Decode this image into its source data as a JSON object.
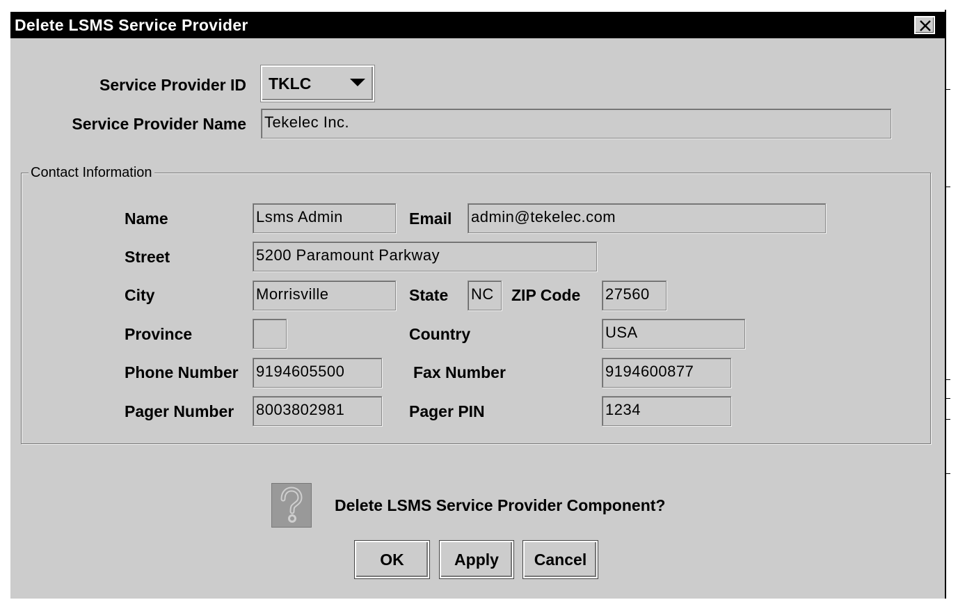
{
  "window": {
    "title": "Delete LSMS Service Provider",
    "close_icon": "close-x-icon"
  },
  "provider": {
    "id_label": "Service Provider ID",
    "id_value": "TKLC",
    "name_label": "Service Provider Name",
    "name_value": "Tekelec Inc."
  },
  "contact": {
    "legend": "Contact Information",
    "name_label": "Name",
    "name_value": "Lsms Admin",
    "email_label": "Email",
    "email_value": "admin@tekelec.com",
    "street_label": "Street",
    "street_value": "5200 Paramount Parkway",
    "city_label": "City",
    "city_value": "Morrisville",
    "state_label": "State",
    "state_value": "NC",
    "zip_label": "ZIP Code",
    "zip_value": "27560",
    "province_label": "Province",
    "province_value": "",
    "country_label": "Country",
    "country_value": "USA",
    "phone_label": "Phone Number",
    "phone_value": "9194605500",
    "fax_label": "Fax Number",
    "fax_value": "9194600877",
    "pager_label": "Pager Number",
    "pager_value": "8003802981",
    "pager_pin_label": "Pager PIN",
    "pager_pin_value": "1234"
  },
  "confirm": {
    "icon": "question-icon",
    "prompt": "Delete LSMS Service Provider Component?"
  },
  "buttons": {
    "ok": "OK",
    "apply": "Apply",
    "cancel": "Cancel"
  }
}
